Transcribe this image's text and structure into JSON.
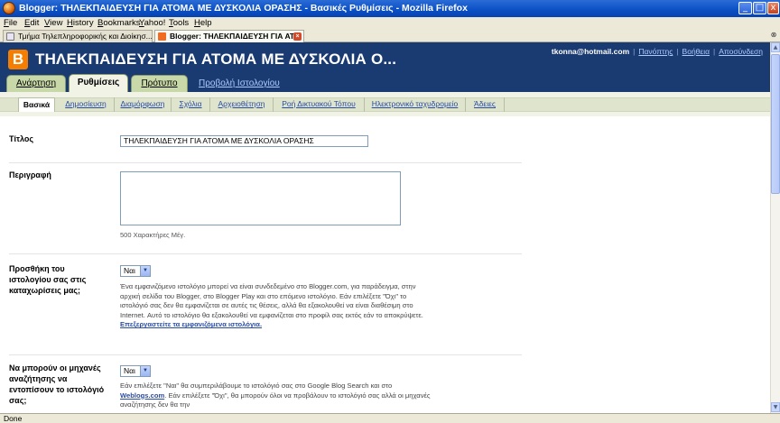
{
  "window": {
    "title": "Blogger: ΤΗΛΕΚΠΑΙΔΕΥΣΗ ΓΙΑ ΑΤΟΜΑ ΜΕ ΔΥΣΚΟΛΙΑ ΟΡΑΣΗΣ - Βασικές Ρυθμίσεις - Mozilla Firefox",
    "minimize": "_",
    "maximize": "□",
    "close": "x"
  },
  "menu": [
    "File",
    "Edit",
    "View",
    "History",
    "Bookmarks",
    "Yahoo!",
    "Tools",
    "Help"
  ],
  "browser_tabs": [
    {
      "label": "Τμήμα Τηλεπληροφορικής και Διοίκησ..."
    },
    {
      "label": "Blogger: ΤΗΛΕΚΠΑΙΔΕΥΣΗ ΓΙΑ ΑΤ..."
    }
  ],
  "blogger": {
    "logo": "B",
    "blog_name": "ΤΗΛΕΚΠΑΙΔΕΥΣΗ ΓΙΑ ΑΤΟΜΑ ΜΕ ΔΥΣΚΟΛΙΑ Ο...",
    "user_email": "tkonna@hotmail.com",
    "user_links": [
      "Πανόπτης",
      "Βοήθεια",
      "Αποσύνδεση"
    ],
    "main_tabs": [
      "Ανάρτηση",
      "Ρυθμίσεις",
      "Πρότυπο"
    ],
    "view_blog": "Προβολή Ιστολογίου",
    "sub_tabs": [
      "Βασικά",
      "Δημοσίευση",
      "Διαμόρφωση",
      "Σχόλια",
      "Αρχειοθέτηση",
      "Ροή Δικτυακού Τόπου",
      "Ηλεκτρονικό ταχυδρομείο",
      "Άδειες"
    ]
  },
  "form": {
    "title_label": "Τίτλος",
    "title_value": "ΤΗΛΕΚΠΑΙΔΕΥΣΗ ΓΙΑ ΑΤΟΜΑ ΜΕ ΔΥΣΚΟΛΙΑ ΟΡΑΣΗΣ",
    "description_label": "Περιγραφή",
    "description_value": "",
    "description_hint": "500 Χαρακτήρες Μέγ.",
    "listing_label": "Προσθήκη του ιστολογίου σας στις καταχωρίσεις μας;",
    "listing_value": "Ναι",
    "listing_desc": "Ένα εμφανιζόμενο ιστολόγιο μπορεί να είναι συνδεδεμένο στο Blogger.com, για παράδειγμα, στην αρχική σελίδα του Blogger, στο Blogger Play και στο επόμενο ιστολόγιο. Εάν επιλέξετε \"Όχι\" το ιστολόγιό σας δεν θα εμφανίζεται σε αυτές τις θέσεις, αλλά θα εξακολουθεί να είναι διαθέσιμη στο Internet. Αυτό το ιστολόγιο θα εξακολουθεί να εμφανίζεται στο προφίλ σας εκτός εάν το αποκρύψετε.",
    "listing_link": "Επεξεργαστείτε τα εμφανιζόμενα ιστολόγια.",
    "search_label": "Να μπορούν οι μηχανές αναζήτησης να εντοπίσουν το ιστολόγιό σας;",
    "search_value": "Ναι",
    "search_desc_1": "Εάν επιλέξετε \"Ναι\" θα συμπεριλάβουμε το ιστολόγιό σας στο Google Blog Search και στο",
    "search_link": "Weblogs.com",
    "search_desc_2": ". Εάν επιλέξετε \"Όχι\", θα μπορούν όλοι να προβάλουν το ιστολόγιό σας αλλά οι μηχανές αναζήτησης δεν θα την"
  },
  "status": "Done"
}
